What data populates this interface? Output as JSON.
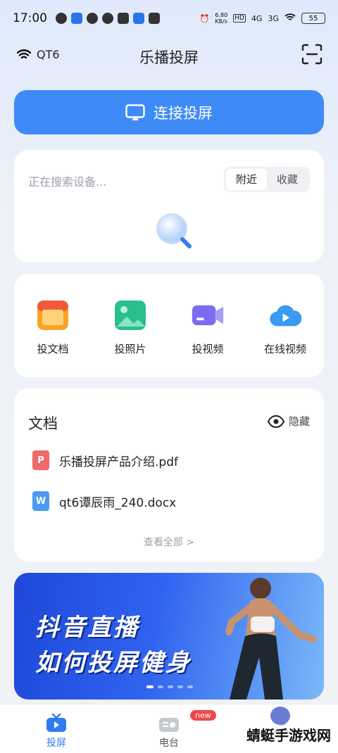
{
  "statusbar": {
    "time": "17:00",
    "net_speed": "6.80\nKB/s",
    "net_speed_top": "6.80",
    "net_speed_bottom": "KB/s",
    "hd": "HD",
    "sig1": "4G",
    "sig2": "3G",
    "battery": "55"
  },
  "topbar": {
    "wifi_name": "QT6",
    "title": "乐播投屏"
  },
  "connect_button": {
    "label": "连接投屏"
  },
  "search": {
    "status": "正在搜索设备...",
    "tabs": [
      {
        "label": "附近"
      },
      {
        "label": "收藏"
      }
    ]
  },
  "tools": [
    {
      "label": "投文档",
      "icon": "document-folder-icon"
    },
    {
      "label": "投照片",
      "icon": "photo-icon"
    },
    {
      "label": "投视频",
      "icon": "video-camera-icon"
    },
    {
      "label": "在线视频",
      "icon": "cloud-play-icon"
    }
  ],
  "documents": {
    "title": "文档",
    "hide_label": "隐藏",
    "items": [
      {
        "name": "乐播投屏产品介绍.pdf",
        "icon": "pdf-file-icon",
        "color": "#f06a6a"
      },
      {
        "name": "qt6谭辰雨_240.docx",
        "icon": "word-file-icon",
        "color": "#4a9bf2"
      }
    ],
    "view_all": "查看全部 >"
  },
  "banner": {
    "line1": "抖音直播",
    "line2": "如何投屏健身"
  },
  "tabbar": {
    "tabs": [
      {
        "label": "投屏",
        "active": true
      },
      {
        "label": "电台",
        "badge": "new"
      },
      {
        "label": ""
      }
    ]
  },
  "watermark": "蜻蜓手游戏网",
  "colors": {
    "accent": "#3e8bf7",
    "badge": "#f0474a"
  }
}
